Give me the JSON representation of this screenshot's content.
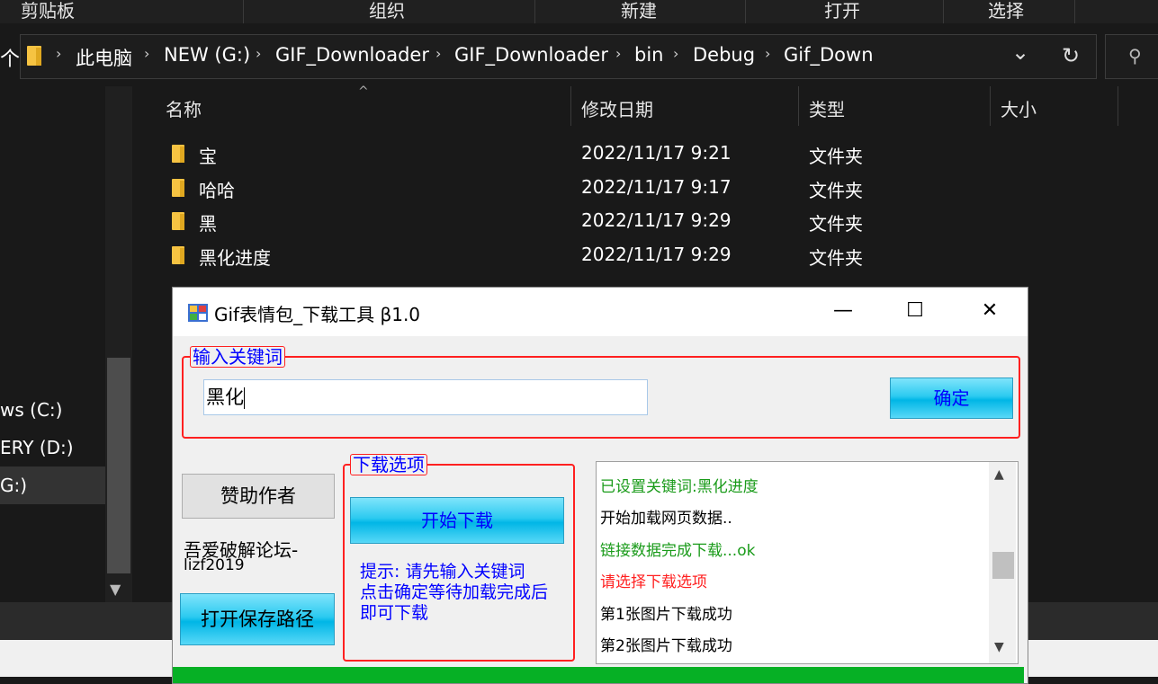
{
  "ribbon": {
    "tabs": [
      "剪贴板",
      "组织",
      "新建",
      "打开",
      "选择"
    ]
  },
  "address": {
    "crumbs": [
      "此电脑",
      "NEW (G:)",
      "GIF_Downloader",
      "GIF_Downloader",
      "bin",
      "Debug",
      "Gif_Down"
    ],
    "up_glyph": "个",
    "dropdown_glyph": "⌄",
    "refresh_glyph": "↻",
    "search_glyph": "⚲"
  },
  "nav": {
    "items": [
      "ws (C:)",
      "ERY (D:)",
      "G:)"
    ]
  },
  "columns": {
    "name": "名称",
    "date": "修改日期",
    "type": "类型",
    "size": "大小"
  },
  "files": [
    {
      "name": "宝",
      "date": "2022/11/17 9:21",
      "type": "文件夹"
    },
    {
      "name": "哈哈",
      "date": "2022/11/17 9:17",
      "type": "文件夹"
    },
    {
      "name": "黑",
      "date": "2022/11/17 9:29",
      "type": "文件夹"
    },
    {
      "name": "黑化进度",
      "date": "2022/11/17 9:29",
      "type": "文件夹"
    }
  ],
  "dialog": {
    "title": "Gif表情包_下载工具   β1.0",
    "minimize": "—",
    "maximize": "☐",
    "close": "✕",
    "keyword_group_label": "输入关键词",
    "keyword_value": "黑化",
    "confirm_label": "确定",
    "sponsor_label": "赞助作者",
    "forum_line1": "吾爱破解论坛-",
    "forum_line2": "lizf2019",
    "open_path_label": "打开保存路径",
    "download_group_label": "下载选项",
    "start_download_label": "开始下载",
    "hint_lines": [
      "提示: 请先输入关键词",
      "点击确定等待加载完成后",
      "即可下载"
    ],
    "log": [
      {
        "text": "已设置关键词:黑化进度",
        "color": "#1a9b1a"
      },
      {
        "text": "开始加载网页数据..",
        "color": "#000000"
      },
      {
        "text": "链接数据完成下载...ok",
        "color": "#1a9b1a"
      },
      {
        "text": "请选择下载选项",
        "color": "#ff2020"
      },
      {
        "text": "第1张图片下载成功",
        "color": "#000000"
      },
      {
        "text": "第2张图片下载成功",
        "color": "#000000"
      }
    ]
  },
  "colors": {
    "group_border": "#ff2020",
    "label_blue": "#0000ff",
    "progress_green": "#06b025"
  }
}
